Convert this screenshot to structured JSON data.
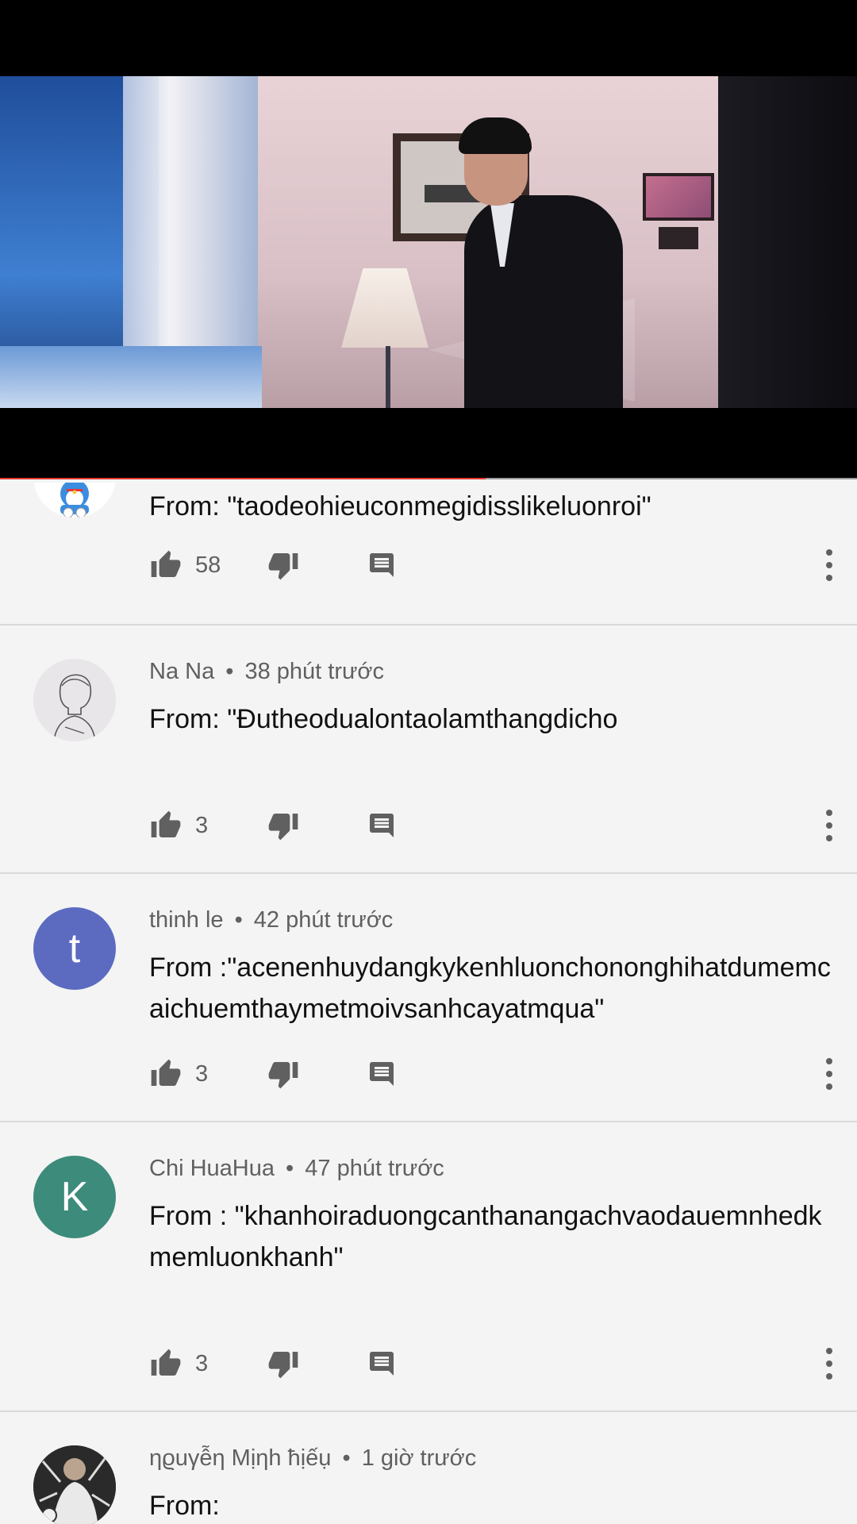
{
  "player": {
    "progress_fraction": 0.567
  },
  "comments": [
    {
      "author": "",
      "time": "",
      "body": "From: \"taodeohieuconmegidisslikeluonroi\"",
      "likes": "58",
      "avatar_letter": "",
      "avatar_color": "#ffffff"
    },
    {
      "author": "Na Na",
      "time": "38 phút trước",
      "body": "From: \"Đutheodualontaolamthangdicho",
      "likes": "3",
      "avatar_letter": "",
      "avatar_color": "#e6e3e6"
    },
    {
      "author": "thinh le",
      "time": "42 phút trước",
      "body": "From :\"acenenhuydangkykenhluonchononghihatdumemcaichuemthaymetmoivsanhcayatmqua\"",
      "likes": "3",
      "avatar_letter": "t",
      "avatar_color": "#5c6bc0"
    },
    {
      "author": "Chi HuaHua",
      "time": "47 phút trước",
      "body": "From : \"khanhoiraduongcanthanangachvaodauemnhedkmemluonkhanh\"",
      "likes": "3",
      "avatar_letter": "K",
      "avatar_color": "#3d8b7a"
    },
    {
      "author": "ηϱuγễη Mịηh ħịếụ",
      "time": "1 giờ trước",
      "body": "From:",
      "likes": "",
      "avatar_letter": "",
      "avatar_color": "#2b2b2b"
    }
  ],
  "separator": "•",
  "icons": {
    "like": "thumb-up-icon",
    "dislike": "thumb-down-icon",
    "reply": "comment-icon",
    "more": "more-vert-icon"
  }
}
